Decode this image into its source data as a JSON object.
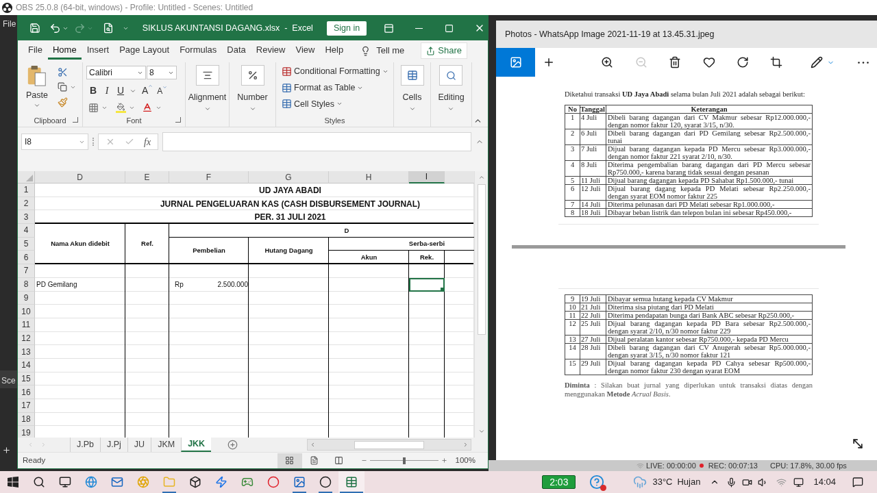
{
  "obs": {
    "title": "OBS 25.0.8 (64-bit, windows) - Profile: Untitled - Scenes: Untitled",
    "menu_fragment": "File",
    "scenes_fragment": "Sce"
  },
  "excel": {
    "title": "SIKLUS AKUNTANSI DAGANG.xlsx  -  Excel",
    "sign_in": "Sign in",
    "menu": [
      {
        "label": "File",
        "selected": false
      },
      {
        "label": "Home",
        "selected": true
      },
      {
        "label": "Insert",
        "selected": false
      },
      {
        "label": "Page Layout",
        "selected": false
      },
      {
        "label": "Formulas",
        "selected": false
      },
      {
        "label": "Data",
        "selected": false
      },
      {
        "label": "Review",
        "selected": false
      },
      {
        "label": "View",
        "selected": false
      },
      {
        "label": "Help",
        "selected": false
      }
    ],
    "tell_me": "Tell me",
    "share": "Share",
    "ribbon": {
      "paste": "Paste",
      "font_name": "Calibri",
      "font_size": "8",
      "bold": "B",
      "italic": "I",
      "underline": "U",
      "grow_font": "A",
      "shrink_font": "A",
      "alignment": "Alignment",
      "number": "Number",
      "conditional_formatting": "Conditional Formatting",
      "format_as_table": "Format as Table",
      "cell_styles": "Cell Styles",
      "cells": "Cells",
      "editing": "Editing",
      "group_labels": [
        "Clipboard",
        "Font",
        "Styles"
      ]
    },
    "name_box": "I8",
    "fx": "fx",
    "columns": [
      {
        "label": "D",
        "selected": false
      },
      {
        "label": "E",
        "selected": false
      },
      {
        "label": "F",
        "selected": false
      },
      {
        "label": "G",
        "selected": false
      },
      {
        "label": "H",
        "selected": false
      },
      {
        "label": "I",
        "selected": true
      }
    ],
    "row_numbers": [
      "1",
      "2",
      "3",
      "4",
      "5",
      "6",
      "7",
      "8",
      "9",
      "10",
      "11",
      "12",
      "13",
      "14",
      "15",
      "16",
      "17",
      "18",
      "19"
    ],
    "sheet_title": [
      "UD JAYA ABADI",
      "JURNAL PENGELUARAN KAS (CASH DISBURSEMENT JOURNAL)",
      "PER. 31 JULI 2021"
    ],
    "header": {
      "account": "Nama Akun didebit",
      "ref": "Ref.",
      "group": "D",
      "purchases": "Pembelian",
      "payables": "Hutang Dagang",
      "misc": "Serba-serbi",
      "misc_account": "Akun",
      "misc_ref": "Rek."
    },
    "body_rows": [
      {
        "selected": false
      },
      {
        "selected": true,
        "account": "PD Gemilang",
        "currency": "Rp",
        "amount": "2.500.000"
      },
      {
        "selected": false
      },
      {
        "selected": false
      },
      {
        "selected": false
      },
      {
        "selected": false
      },
      {
        "selected": false
      },
      {
        "selected": false
      },
      {
        "selected": false
      },
      {
        "selected": false
      },
      {
        "selected": false
      },
      {
        "selected": false
      },
      {
        "selected": false
      }
    ],
    "sheet_tabs": [
      {
        "label": "J.Pb",
        "selected": false
      },
      {
        "label": "J.Pj",
        "selected": false
      },
      {
        "label": "JU",
        "selected": false
      },
      {
        "label": "JKM",
        "selected": false
      },
      {
        "label": "JKK",
        "selected": true
      }
    ],
    "status": "Ready",
    "zoom": "100%",
    "zoom_slider": {
      "level": 0.5
    }
  },
  "photos": {
    "title": "Photos - WhatsApp Image 2021-11-19 at 13.45.31.jpeg",
    "toolbar": [
      {
        "selected": true,
        "disabled": false
      },
      {
        "selected": false,
        "disabled": false
      },
      {
        "selected": false,
        "disabled": false
      },
      {
        "selected": false,
        "disabled": true
      },
      {
        "selected": false,
        "disabled": false
      },
      {
        "selected": false,
        "disabled": false
      },
      {
        "selected": false,
        "disabled": false
      },
      {
        "selected": false,
        "disabled": false
      },
      {
        "selected": false,
        "disabled": false
      },
      {
        "selected": false,
        "disabled": false
      }
    ],
    "intro": "Diketahui transaksi **UD Jaya Abadi** selama bulan Juli 2021 adalah sebagai berikut:",
    "table_header": [
      "No",
      "Tanggal",
      "Keterangan"
    ],
    "rows_page_1": [
      {
        "no": "1",
        "date": "4 Juli",
        "text": "Dibeli barang dagangan dari CV Makmur sebesar Rp12.000.000,- dengan nomor faktur 120, syarat 3/15, n/30."
      },
      {
        "no": "2",
        "date": "6 Juli",
        "text": "Dibeli barang dagangan dari PD Gemilang sebesar Rp2.500.000,- tunai"
      },
      {
        "no": "3",
        "date": "7 Juli",
        "text": "Dijual barang dagangan kepada PD Mercu sebesar Rp3.000.000,- dengan nomor faktur 221 syarat 2/10, n/30."
      },
      {
        "no": "4",
        "date": "8 Juli",
        "text": "Diterima pengembalian barang dagangan dari PD Mercu sebesar Rp750.000,- karena barang tidak sesuai dengan pesanan"
      },
      {
        "no": "5",
        "date": "11 Juli",
        "text": "Dijual barang dagangan kepada PD Sahabat Rp1.500.000,- tunai"
      },
      {
        "no": "6",
        "date": "12 Juli",
        "text": "Dijual barang dagang kepada PD Melati sebesar Rp2.250.000,- dengan syarat EOM nomor faktur 225"
      },
      {
        "no": "7",
        "date": "14 Juli",
        "text": "Diterima pelunasan dari PD Melati sebesar Rp1.000.000,-"
      },
      {
        "no": "8",
        "date": "18 Juli",
        "text": "Dibayar beban listrik dan telepon bulan ini sebesar Rp450.000,-"
      }
    ],
    "rows_page_2": [
      {
        "no": "9",
        "date": "19 Juli",
        "text": "Dibayar semua hutang kepada CV Makmur"
      },
      {
        "no": "10",
        "date": "21 Juli",
        "text": "Diterima sisa piutang dari PD Melati"
      },
      {
        "no": "11",
        "date": "22 Juli",
        "text": "Diterima pendapatan bunga dari Bank ABC sebesar Rp250.000,-"
      },
      {
        "no": "12",
        "date": "25 Juli",
        "text": "Dijual barang dagangan kepada PD Bara sebesar Rp2.500.000,- dengan syarat 2/10, n/30 nomor faktur 229"
      },
      {
        "no": "13",
        "date": "27 Juli",
        "text": "Dijual peralatan kantor sebesar Rp750.000,- kepada PD Mercu"
      },
      {
        "no": "14",
        "date": "28 Juli",
        "text": "Dibeli barang dagangan dari CV Anugerah sebesar Rp5.000.000,- dengan syarat 3/15, n/30 nomor faktur 121"
      },
      {
        "no": "15",
        "date": "29 Juli",
        "text": "Dijual barang dagangan kepada PD Cahya sebesar Rp500.000,- dengan nomor faktur 230 dengan syarat EOM"
      }
    ],
    "request": "**Diminta** : Silakan buat jurnal yang diperlukan untuk transaksi diatas dengan menggunakan **Metode** *Acrual Basis*."
  },
  "obs_status": {
    "live": "LIVE: 00:00:00",
    "rec": "REC: 00:07:13",
    "cpu": "CPU: 17.8%, 30.00 fps"
  },
  "taskbar": {
    "apps": [
      {
        "running": false,
        "selected": false
      },
      {
        "running": false,
        "selected": false
      },
      {
        "running": false,
        "selected": false
      },
      {
        "running": false,
        "selected": false
      },
      {
        "running": false,
        "selected": false
      },
      {
        "running": false,
        "selected": false
      },
      {
        "running": true,
        "selected": false
      },
      {
        "running": false,
        "selected": false
      },
      {
        "running": false,
        "selected": false
      },
      {
        "running": false,
        "selected": false
      },
      {
        "running": false,
        "selected": false
      },
      {
        "running": true,
        "selected": false
      },
      {
        "running": true,
        "selected": false
      },
      {
        "running": true,
        "selected": true
      }
    ],
    "battery": "2:03",
    "temperature": "33°C",
    "weather": "Hujan",
    "clock": "14:04"
  }
}
